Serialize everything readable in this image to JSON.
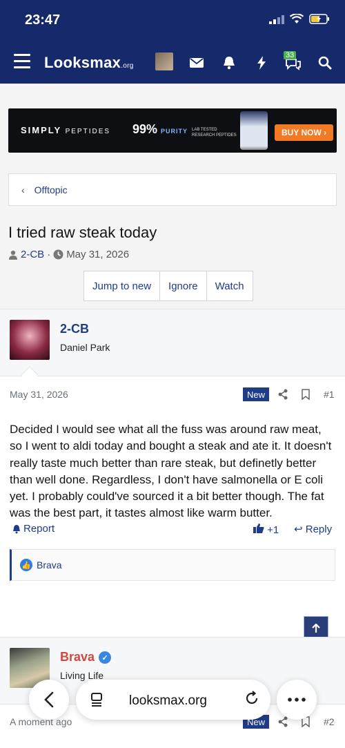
{
  "status_bar": {
    "time": "23:47"
  },
  "nav": {
    "logo_main": "Looksmax",
    "logo_suffix": ".org",
    "alerts_badge": "33"
  },
  "banner": {
    "brand": "SIMPLY",
    "brand_sub": "PEPTIDES",
    "purity_value": "99%",
    "purity_label": "PURITY",
    "lab_line1": "LAB TESTED",
    "lab_line2": "RESEARCH PEPTIDES",
    "cta": "BUY NOW ›"
  },
  "breadcrumb": {
    "label": "Offtopic"
  },
  "thread": {
    "title": "I tried raw steak today",
    "author": "2-CB",
    "date": "May 31, 2026",
    "buttons": [
      "Jump to new",
      "Ignore",
      "Watch"
    ]
  },
  "posts": [
    {
      "username": "2-CB",
      "user_title": "Daniel Park",
      "date": "May 31, 2026",
      "badge": "New",
      "number": "#1",
      "body": "Decided I would see what all the fuss was around raw meat, so I went to aldi today and bought a steak and ate it. It doesn't really taste much better than rare steak, but definetly better than well done. Regardless, I don't have salmonella or E coli yet. I probably could've sourced it a bit better though. The fat was the best part, it tastes almost like warm butter.",
      "report_label": "Report",
      "like_count": "+1",
      "reply_label": "Reply",
      "reaction_user": "Brava"
    },
    {
      "username": "Brava",
      "user_title": "Living Life",
      "date": "A moment ago",
      "badge": "New",
      "number": "#2"
    }
  ],
  "browser": {
    "url": "looksmax.org"
  },
  "colors": {
    "nav_bg": "#15296b",
    "link": "#1f3c88",
    "username_red": "#d9453c",
    "cta_orange": "#f27a24"
  }
}
